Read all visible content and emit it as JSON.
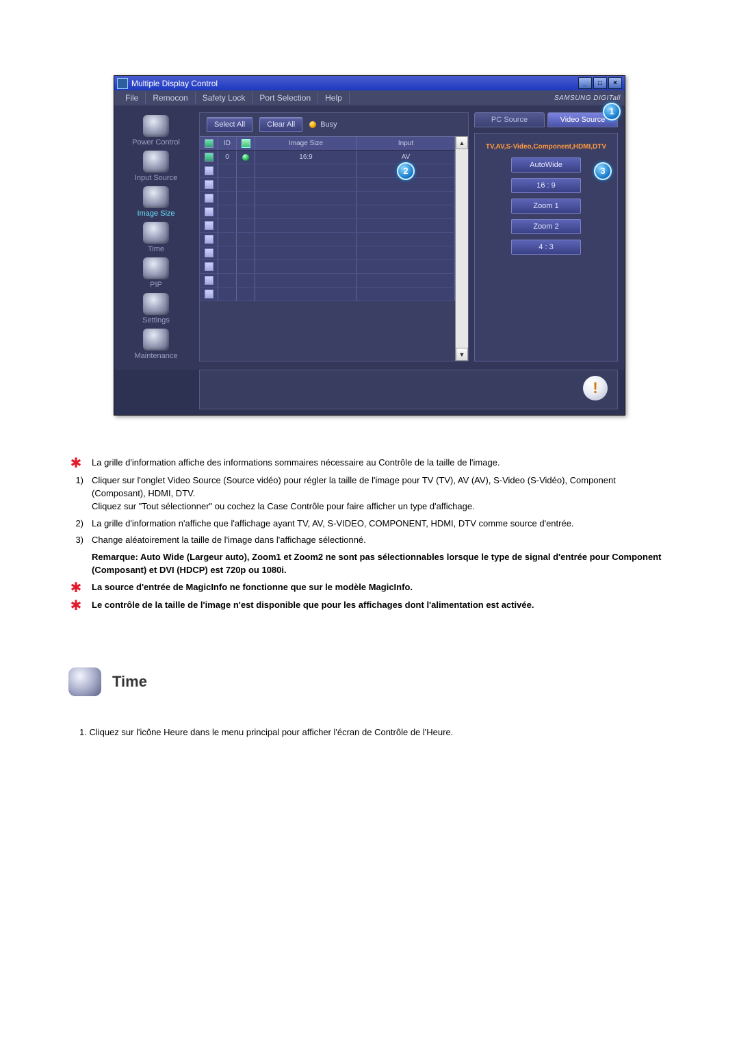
{
  "app": {
    "window_title": "Multiple Display Control",
    "brand": "SAMSUNG DIGITall",
    "menu": [
      "File",
      "Remocon",
      "Safety Lock",
      "Port Selection",
      "Help"
    ],
    "sidebar": [
      {
        "label": "Power Control"
      },
      {
        "label": "Input Source"
      },
      {
        "label": "Image Size"
      },
      {
        "label": "Time"
      },
      {
        "label": "PIP"
      },
      {
        "label": "Settings"
      },
      {
        "label": "Maintenance"
      }
    ],
    "toolbar": {
      "select_all": "Select All",
      "clear_all": "Clear All",
      "busy": "Busy"
    },
    "grid": {
      "headers": {
        "id": "ID",
        "image_size": "Image Size",
        "input": "Input"
      },
      "row0": {
        "id": "0",
        "image_size": "16:9",
        "input": "AV"
      }
    },
    "right": {
      "tab_pc": "PC Source",
      "tab_video": "Video Source",
      "panel_label": "TV,AV,S-Video,Component,HDMI,DTV",
      "options": [
        "AutoWide",
        "16 : 9",
        "Zoom 1",
        "Zoom 2",
        "4 : 3"
      ]
    },
    "callouts": {
      "c1": "1",
      "c2": "2",
      "c3": "3"
    }
  },
  "doc": {
    "items": [
      {
        "marker": "star",
        "text": "La grille d'information affiche des informations sommaires nécessaire au Contrôle de la taille de l'image."
      },
      {
        "marker": "1)",
        "text": "Cliquer sur l'onglet Video Source (Source vidéo) pour régler la taille de l'image pour TV (TV), AV (AV), S-Video (S-Vidéo), Component (Composant), HDMI, DTV.\nCliquez sur \"Tout sélectionner\" ou cochez la Case Contrôle pour faire afficher un type d'affichage."
      },
      {
        "marker": "2)",
        "text": "La grille d'information n'affiche que l'affichage ayant TV, AV, S-VIDEO, COMPONENT, HDMI, DTV comme source d'entrée."
      },
      {
        "marker": "3)",
        "text": "Change aléatoirement la taille de l'image dans l'affichage sélectionné."
      },
      {
        "marker": "",
        "bold": true,
        "text": "Remarque: Auto Wide (Largeur auto), Zoom1 et Zoom2 ne sont pas sélectionnables lorsque le type de signal d'entrée pour Component (Composant) et DVI (HDCP) est 720p ou 1080i."
      },
      {
        "marker": "star",
        "bold": true,
        "text": "La source d'entrée de MagicInfo ne fonctionne que sur le modèle MagicInfo."
      },
      {
        "marker": "star",
        "bold": true,
        "text": "Le contrôle de la taille de l'image n'est disponible que pour les affichages dont l'alimentation est activée."
      }
    ],
    "time": {
      "heading": "Time",
      "body": "1.  Cliquez sur l'icône Heure dans le menu principal pour afficher l'écran de Contrôle de l'Heure."
    }
  }
}
